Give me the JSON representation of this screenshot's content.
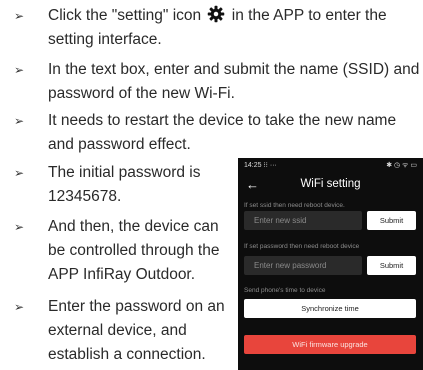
{
  "instructions": [
    {
      "marker": "➢",
      "lines": [
        "Click the \"setting\" icon",
        "in the APP to enter the",
        "setting interface."
      ]
    },
    {
      "marker": "➢",
      "lines": [
        "In the text box, enter and submit the name (SSID) and",
        "password of the new Wi-Fi."
      ]
    },
    {
      "marker": "➢",
      "lines": [
        "It needs to restart the device to take the new name",
        "and password effect."
      ]
    },
    {
      "marker": "➢",
      "lines": [
        "The initial password is",
        "12345678."
      ]
    },
    {
      "marker": "➢",
      "lines": [
        "And then, the device can",
        "be controlled through the",
        "APP InfiRay Outdoor."
      ]
    },
    {
      "marker": "➢",
      "lines": [
        "Enter the password on an",
        "external device, and",
        "establish a connection."
      ]
    }
  ],
  "phone": {
    "status_left": "14:25 ⁝⁝ ···",
    "status_right": "✱ ◷ ᯤ ▭",
    "back": "←",
    "title": "WiFi setting",
    "ssid_label": "If set ssid then need reboot device.",
    "ssid_placeholder": "Enter new ssid",
    "ssid_submit": "Submit",
    "pwd_label": "If set password then need reboot device",
    "pwd_placeholder": "Enter new password",
    "pwd_submit": "Submit",
    "time_label": "Send phone's time to device",
    "sync_button": "Synchronize time",
    "upgrade_button": "WiFi firmware upgrade"
  },
  "colors": {
    "phone_bg": "#0d0d0d",
    "field_bg": "#2a2a2a",
    "upgrade": "#e8453c"
  },
  "icons": {
    "setting": "gear-icon"
  }
}
